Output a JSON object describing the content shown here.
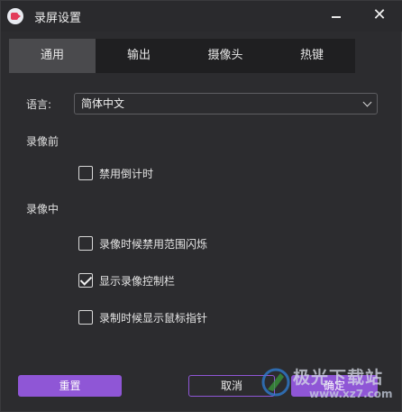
{
  "window": {
    "title": "录屏设置",
    "app_icon": "screen-recorder-icon",
    "minimize_icon": "minimize-icon",
    "close_icon": "close-icon",
    "close_glyph": "✕"
  },
  "tabs": [
    {
      "label": "通用",
      "active": true
    },
    {
      "label": "输出",
      "active": false
    },
    {
      "label": "摄像头",
      "active": false
    },
    {
      "label": "热键",
      "active": false
    }
  ],
  "general": {
    "language_label": "语言:",
    "language_value": "简体中文",
    "before_section": "录像前",
    "during_section": "录像中",
    "options": {
      "disable_countdown": {
        "label": "禁用倒计时",
        "checked": false
      },
      "disable_flash": {
        "label": "录像时候禁用范围闪烁",
        "checked": false
      },
      "show_controlbar": {
        "label": "显示录像控制栏",
        "checked": true
      },
      "show_cursor_pointer": {
        "label": "录制时候显示鼠标指针",
        "checked": false
      }
    }
  },
  "buttons": {
    "reset": "重置",
    "cancel": "取消",
    "ok": "确定"
  },
  "watermark": {
    "text": "极光下载站",
    "url": "www.xz7.com"
  },
  "colors": {
    "accent": "#8f56d6",
    "background": "#2c2c2f",
    "tab_active": "#4a4a4d",
    "tab_bar": "#1f1f21"
  }
}
